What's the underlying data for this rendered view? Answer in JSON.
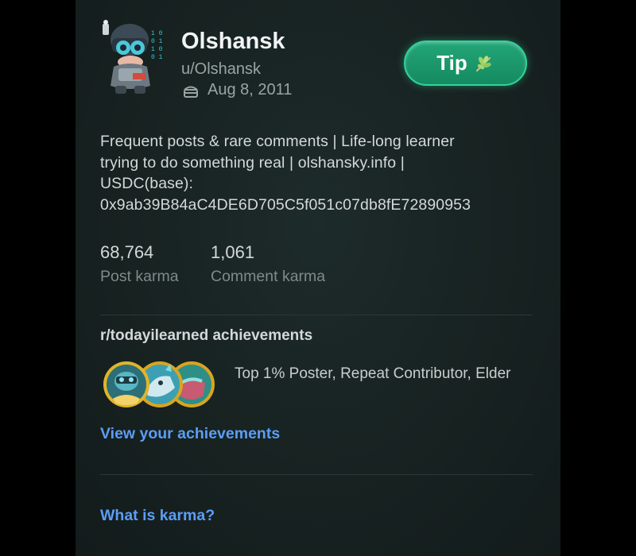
{
  "profile": {
    "display_name": "Olshansk",
    "handle": "u/Olshansk",
    "cake_day": "Aug 8, 2011",
    "bio": "Frequent posts & rare comments | Life-long learner\ntrying to do something real | olshansky.info |\nUSDC(base):\n0x9ab39B84aC4DE6D705C5f051c07db8fE72890953",
    "avatar_icon": "avatar-icon",
    "cake_icon": "cake-icon"
  },
  "tip_button": {
    "label": "Tip",
    "icon": "leaf-icon",
    "color": "#1a9a6c"
  },
  "karma": {
    "post": {
      "value": "68,764",
      "label": "Post karma"
    },
    "comment": {
      "value": "1,061",
      "label": "Comment karma"
    }
  },
  "achievements": {
    "title": "r/todayilearned achievements",
    "list_text": "Top 1% Poster, Repeat Contributor, Elder",
    "badge_icons": [
      "badge-top-poster-icon",
      "badge-repeat-contributor-icon",
      "badge-elder-icon"
    ],
    "view_link": "View your achievements"
  },
  "karma_help_link": "What is karma?",
  "colors": {
    "link": "#5b9df5",
    "background": "#172221",
    "accent": "#2fd49a"
  }
}
